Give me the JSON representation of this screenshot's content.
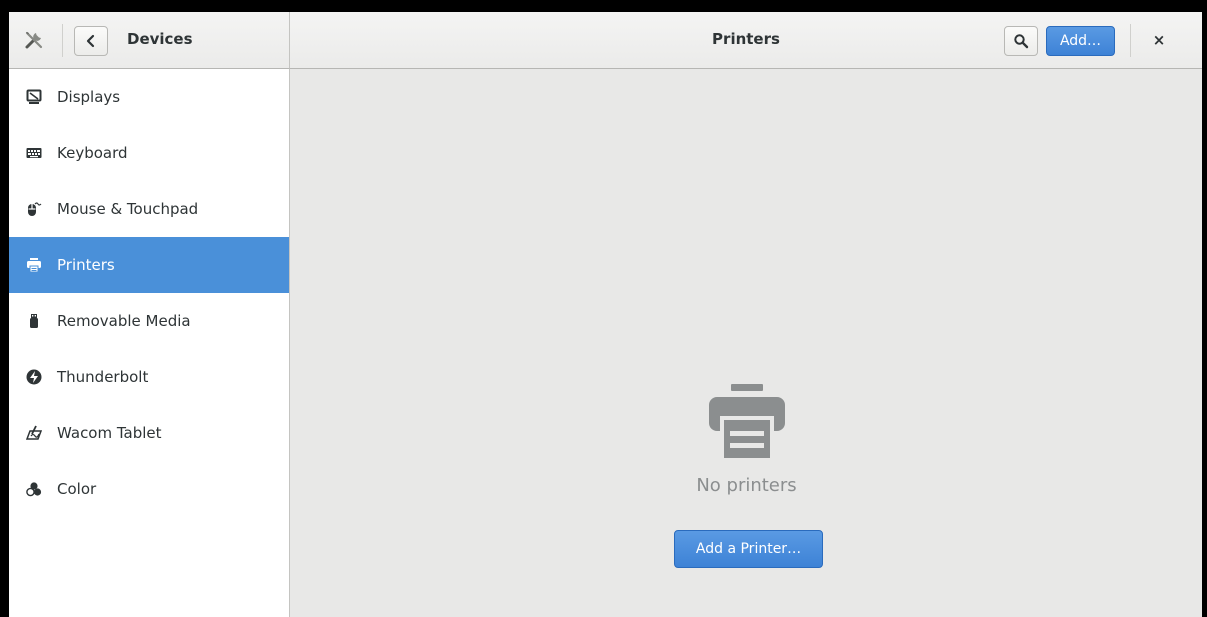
{
  "header": {
    "sidebar_title": "Devices",
    "title": "Printers",
    "add_label": "Add…",
    "close_label": "×"
  },
  "sidebar": {
    "items": [
      {
        "label": "Displays",
        "icon": "display-icon"
      },
      {
        "label": "Keyboard",
        "icon": "keyboard-icon"
      },
      {
        "label": "Mouse & Touchpad",
        "icon": "mouse-icon"
      },
      {
        "label": "Printers",
        "icon": "printer-icon",
        "selected": true
      },
      {
        "label": "Removable Media",
        "icon": "usb-icon"
      },
      {
        "label": "Thunderbolt",
        "icon": "thunderbolt-icon"
      },
      {
        "label": "Wacom Tablet",
        "icon": "tablet-icon"
      },
      {
        "label": "Color",
        "icon": "color-icon"
      }
    ]
  },
  "main": {
    "empty_label": "No printers",
    "add_printer_label": "Add a Printer…"
  },
  "colors": {
    "accent": "#4a90d9",
    "window_bg": "#e8e8e7",
    "sidebar_bg": "#ffffff"
  }
}
